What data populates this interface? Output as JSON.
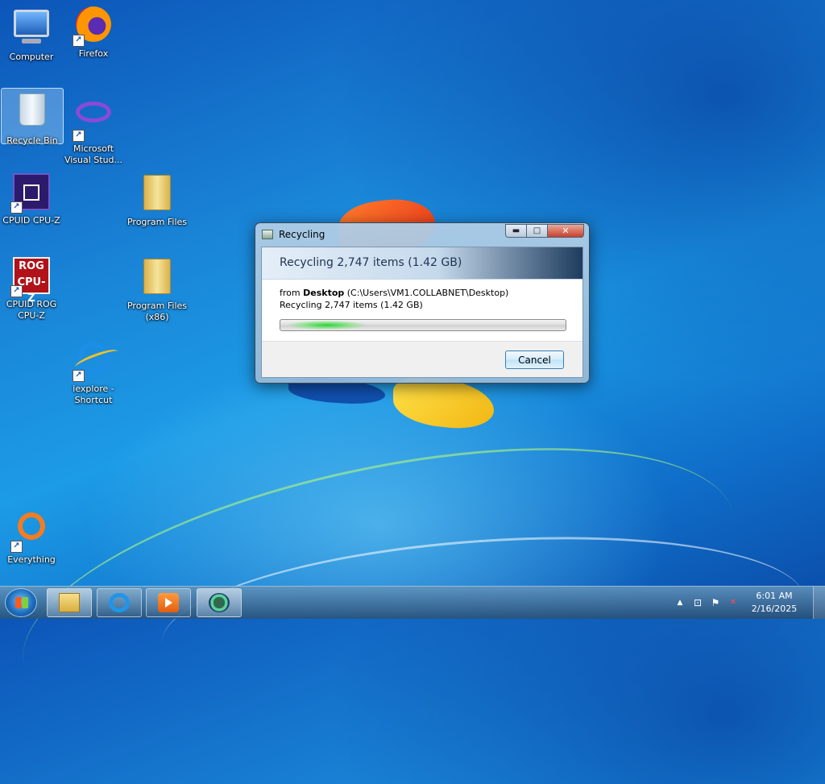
{
  "desktop": {
    "icons": [
      {
        "label": "Computer",
        "icon": "computer-icon"
      },
      {
        "label": "Firefox",
        "icon": "firefox-icon"
      },
      {
        "label": "Recycle Bin",
        "icon": "recycle-bin-icon"
      },
      {
        "label": "Microsoft Visual Stud...",
        "icon": "visual-studio-icon"
      },
      {
        "label": "CPUID CPU-Z",
        "icon": "cpuz-icon"
      },
      {
        "label": "Program Files",
        "icon": "folder-icon"
      },
      {
        "label": "CPUID ROG CPU-Z",
        "icon": "rog-cpuz-icon"
      },
      {
        "label": "Program Files (x86)",
        "icon": "folder-icon"
      },
      {
        "label": "iexplore - Shortcut",
        "icon": "ie-icon"
      },
      {
        "label": "Everything",
        "icon": "everything-icon"
      }
    ],
    "rog_icon_text": "ROG CPU-Z"
  },
  "dialog": {
    "title": "Recycling",
    "heading": "Recycling 2,747 items (1.42 GB)",
    "from_prefix": "from ",
    "from_name": "Desktop",
    "from_path": " (C:\\Users\\VM1.COLLABNET\\Desktop)",
    "status": "Recycling 2,747 items (1.42 GB)",
    "progress": 0.3,
    "cancel_label": "Cancel",
    "controls": {
      "minimize": "▬",
      "maximize": "□",
      "close": "✕"
    }
  },
  "taskbar": {
    "apps": [
      "windows-explorer",
      "internet-explorer",
      "windows-media-player",
      "recycling-app"
    ],
    "tray": {
      "chevron": "▲",
      "network": "⊡",
      "flag": "⚑",
      "volume": "✕"
    },
    "clock": {
      "time": "6:01 AM",
      "date": "2/16/2025"
    }
  },
  "colors": {
    "accent": "#1c9be6",
    "close_button": "#c7402a",
    "progress_green": "#2ed13e"
  }
}
